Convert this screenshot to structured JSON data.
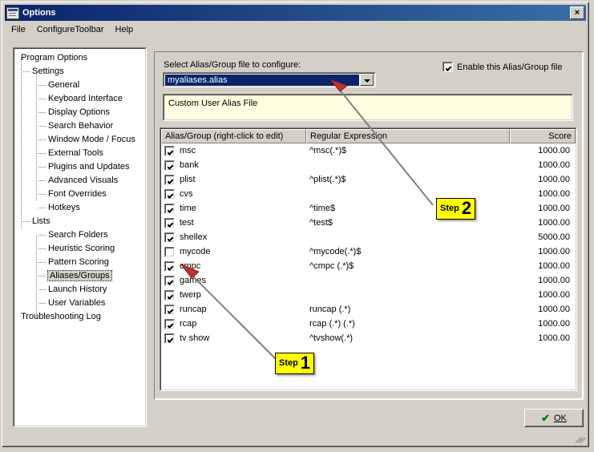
{
  "window": {
    "title": "Options",
    "icon": "window-options-icon",
    "close_label": "×"
  },
  "menubar": {
    "items": [
      {
        "label": "File",
        "name": "menu-file"
      },
      {
        "label": "ConfigureToolbar",
        "name": "menu-configure-toolbar"
      },
      {
        "label": "Help",
        "name": "menu-help"
      }
    ]
  },
  "tree": {
    "nodes": [
      {
        "label": "Program Options",
        "level": 0,
        "selected": false,
        "name": "tree-item-program-options"
      },
      {
        "label": "Settings",
        "level": 1,
        "selected": false,
        "name": "tree-item-settings"
      },
      {
        "label": "General",
        "level": 2,
        "selected": false,
        "name": "tree-item-general"
      },
      {
        "label": "Keyboard Interface",
        "level": 2,
        "selected": false,
        "name": "tree-item-keyboard-interface"
      },
      {
        "label": "Display Options",
        "level": 2,
        "selected": false,
        "name": "tree-item-display-options"
      },
      {
        "label": "Search Behavior",
        "level": 2,
        "selected": false,
        "name": "tree-item-search-behavior"
      },
      {
        "label": "Window Mode / Focus",
        "level": 2,
        "selected": false,
        "name": "tree-item-window-mode-focus"
      },
      {
        "label": "External Tools",
        "level": 2,
        "selected": false,
        "name": "tree-item-external-tools"
      },
      {
        "label": "Plugins and Updates",
        "level": 2,
        "selected": false,
        "name": "tree-item-plugins-and-updates"
      },
      {
        "label": "Advanced Visuals",
        "level": 2,
        "selected": false,
        "name": "tree-item-advanced-visuals"
      },
      {
        "label": "Font Overrides",
        "level": 2,
        "selected": false,
        "name": "tree-item-font-overrides"
      },
      {
        "label": "Hotkeys",
        "level": 2,
        "selected": false,
        "name": "tree-item-hotkeys"
      },
      {
        "label": "Lists",
        "level": 1,
        "selected": false,
        "name": "tree-item-lists"
      },
      {
        "label": "Search Folders",
        "level": 2,
        "selected": false,
        "name": "tree-item-search-folders"
      },
      {
        "label": "Heuristic Scoring",
        "level": 2,
        "selected": false,
        "name": "tree-item-heuristic-scoring"
      },
      {
        "label": "Pattern Scoring",
        "level": 2,
        "selected": false,
        "name": "tree-item-pattern-scoring"
      },
      {
        "label": "Aliases/Groups",
        "level": 2,
        "selected": true,
        "name": "tree-item-aliases-groups"
      },
      {
        "label": "Launch History",
        "level": 2,
        "selected": false,
        "name": "tree-item-launch-history"
      },
      {
        "label": "User Variables",
        "level": 2,
        "selected": false,
        "name": "tree-item-user-variables"
      },
      {
        "label": "Troubleshooting Log",
        "level": 0,
        "selected": false,
        "name": "tree-item-troubleshooting-log"
      }
    ]
  },
  "panel": {
    "select_label": "Select Alias/Group file to configure:",
    "combo_value": "myaliases.alias",
    "enable_checkbox": {
      "label": "Enable this Alias/Group file",
      "checked": true
    },
    "description": "Custom User Alias File"
  },
  "list": {
    "columns": [
      "Alias/Group (right-click to edit)",
      "Regular Expression",
      "Score"
    ],
    "rows": [
      {
        "checked": true,
        "alias": "msc",
        "regex": "^msc(.*)$",
        "score": "1000.00"
      },
      {
        "checked": true,
        "alias": "bank",
        "regex": "",
        "score": "1000.00"
      },
      {
        "checked": true,
        "alias": "plist",
        "regex": "^plist(.*)$",
        "score": "1000.00"
      },
      {
        "checked": true,
        "alias": "cvs",
        "regex": "",
        "score": "1000.00"
      },
      {
        "checked": true,
        "alias": "time",
        "regex": "^time$",
        "score": "1000.00"
      },
      {
        "checked": true,
        "alias": "test",
        "regex": "^test$",
        "score": "1000.00"
      },
      {
        "checked": true,
        "alias": "shellex",
        "regex": "",
        "score": "5000.00"
      },
      {
        "checked": false,
        "alias": "mycode",
        "regex": "^mycode(.*)$",
        "score": "1000.00"
      },
      {
        "checked": true,
        "alias": "cmpc",
        "regex": "^cmpc (.*)$",
        "score": "1000.00"
      },
      {
        "checked": true,
        "alias": "games",
        "regex": "",
        "score": "1000.00"
      },
      {
        "checked": true,
        "alias": "twerp",
        "regex": "",
        "score": "1000.00"
      },
      {
        "checked": true,
        "alias": "runcap",
        "regex": "runcap (.*)",
        "score": "1000.00"
      },
      {
        "checked": true,
        "alias": "rcap",
        "regex": "rcap (.*) (.*)",
        "score": "1000.00"
      },
      {
        "checked": true,
        "alias": "tv show",
        "regex": "^tvshow(.*)",
        "score": "1000.00"
      }
    ]
  },
  "footer": {
    "ok_label": "OK",
    "ok_icon": "check-icon"
  },
  "callouts": [
    {
      "text": "Step",
      "number": "2",
      "name": "callout-step-2"
    },
    {
      "text": "Step",
      "number": "1",
      "name": "callout-step-1"
    }
  ],
  "colors": {
    "accent": "#0a246a",
    "callout_fill": "#ffff00",
    "arrow": "#808080",
    "tooltip_bg": "#ffffe1",
    "face": "#d4d0c8"
  }
}
